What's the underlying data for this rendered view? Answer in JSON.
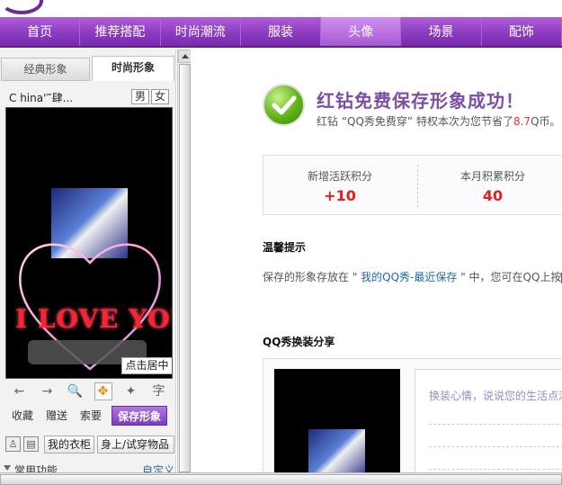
{
  "nav": {
    "items": [
      "首页",
      "推荐搭配",
      "时尚潮流",
      "服装",
      "头像",
      "场景",
      "配饰"
    ],
    "active_index": 4
  },
  "left": {
    "tabs": {
      "classic": "经典形象",
      "fashion": "时尚形象"
    },
    "nickname": "C hina'‴肆...",
    "sex": {
      "male": "男",
      "female": "女"
    },
    "stage_text": "I LOVE YOU",
    "center_button": "点击居中",
    "tools": [
      {
        "icon": "undo-arrow-icon",
        "glyph": "←"
      },
      {
        "icon": "redo-arrow-icon",
        "glyph": "→"
      },
      {
        "icon": "zoom-icon",
        "glyph": "🔍"
      },
      {
        "icon": "move-icon",
        "glyph": "✥"
      },
      {
        "icon": "magic-wand-icon",
        "glyph": "✦"
      },
      {
        "icon": "text-icon",
        "glyph": "字"
      }
    ],
    "actions": {
      "favorite": "收藏",
      "gift": "赠送",
      "ask": "索要",
      "save": "保存形象"
    },
    "closet": {
      "my_closet": "我的衣柜",
      "try_on": "身上/试穿物品"
    },
    "common": {
      "label": "常用功能",
      "custom": "自定义"
    }
  },
  "right": {
    "success_title": "红钻免费保存形象成功！",
    "success_sub_prefix": "红钻 “QQ秀免费穿” 特权本次为您节省了",
    "saved_amount": "8.7",
    "success_sub_suffix": "Q币。",
    "scores": {
      "active_label": "新增活跃积分",
      "active_value": "+10",
      "month_label": "本月积累积分",
      "month_value": "40"
    },
    "tips_title": "温馨提示",
    "tips_prefix": "保存的形象存放在 \" ",
    "tips_link": "我的QQ秀-最近保存",
    "tips_suffix": " \" 中，您可在QQ上按",
    "share_title": "QQ秀换装分享",
    "share_placeholder": "换装心情，说说您的生活点滴"
  },
  "colors": {
    "nav_purple": "#8c3cc0",
    "title_purple": "#7a4fa8",
    "score_red": "#e02020",
    "link_blue": "#2266aa",
    "check_green": "#5fb219"
  }
}
